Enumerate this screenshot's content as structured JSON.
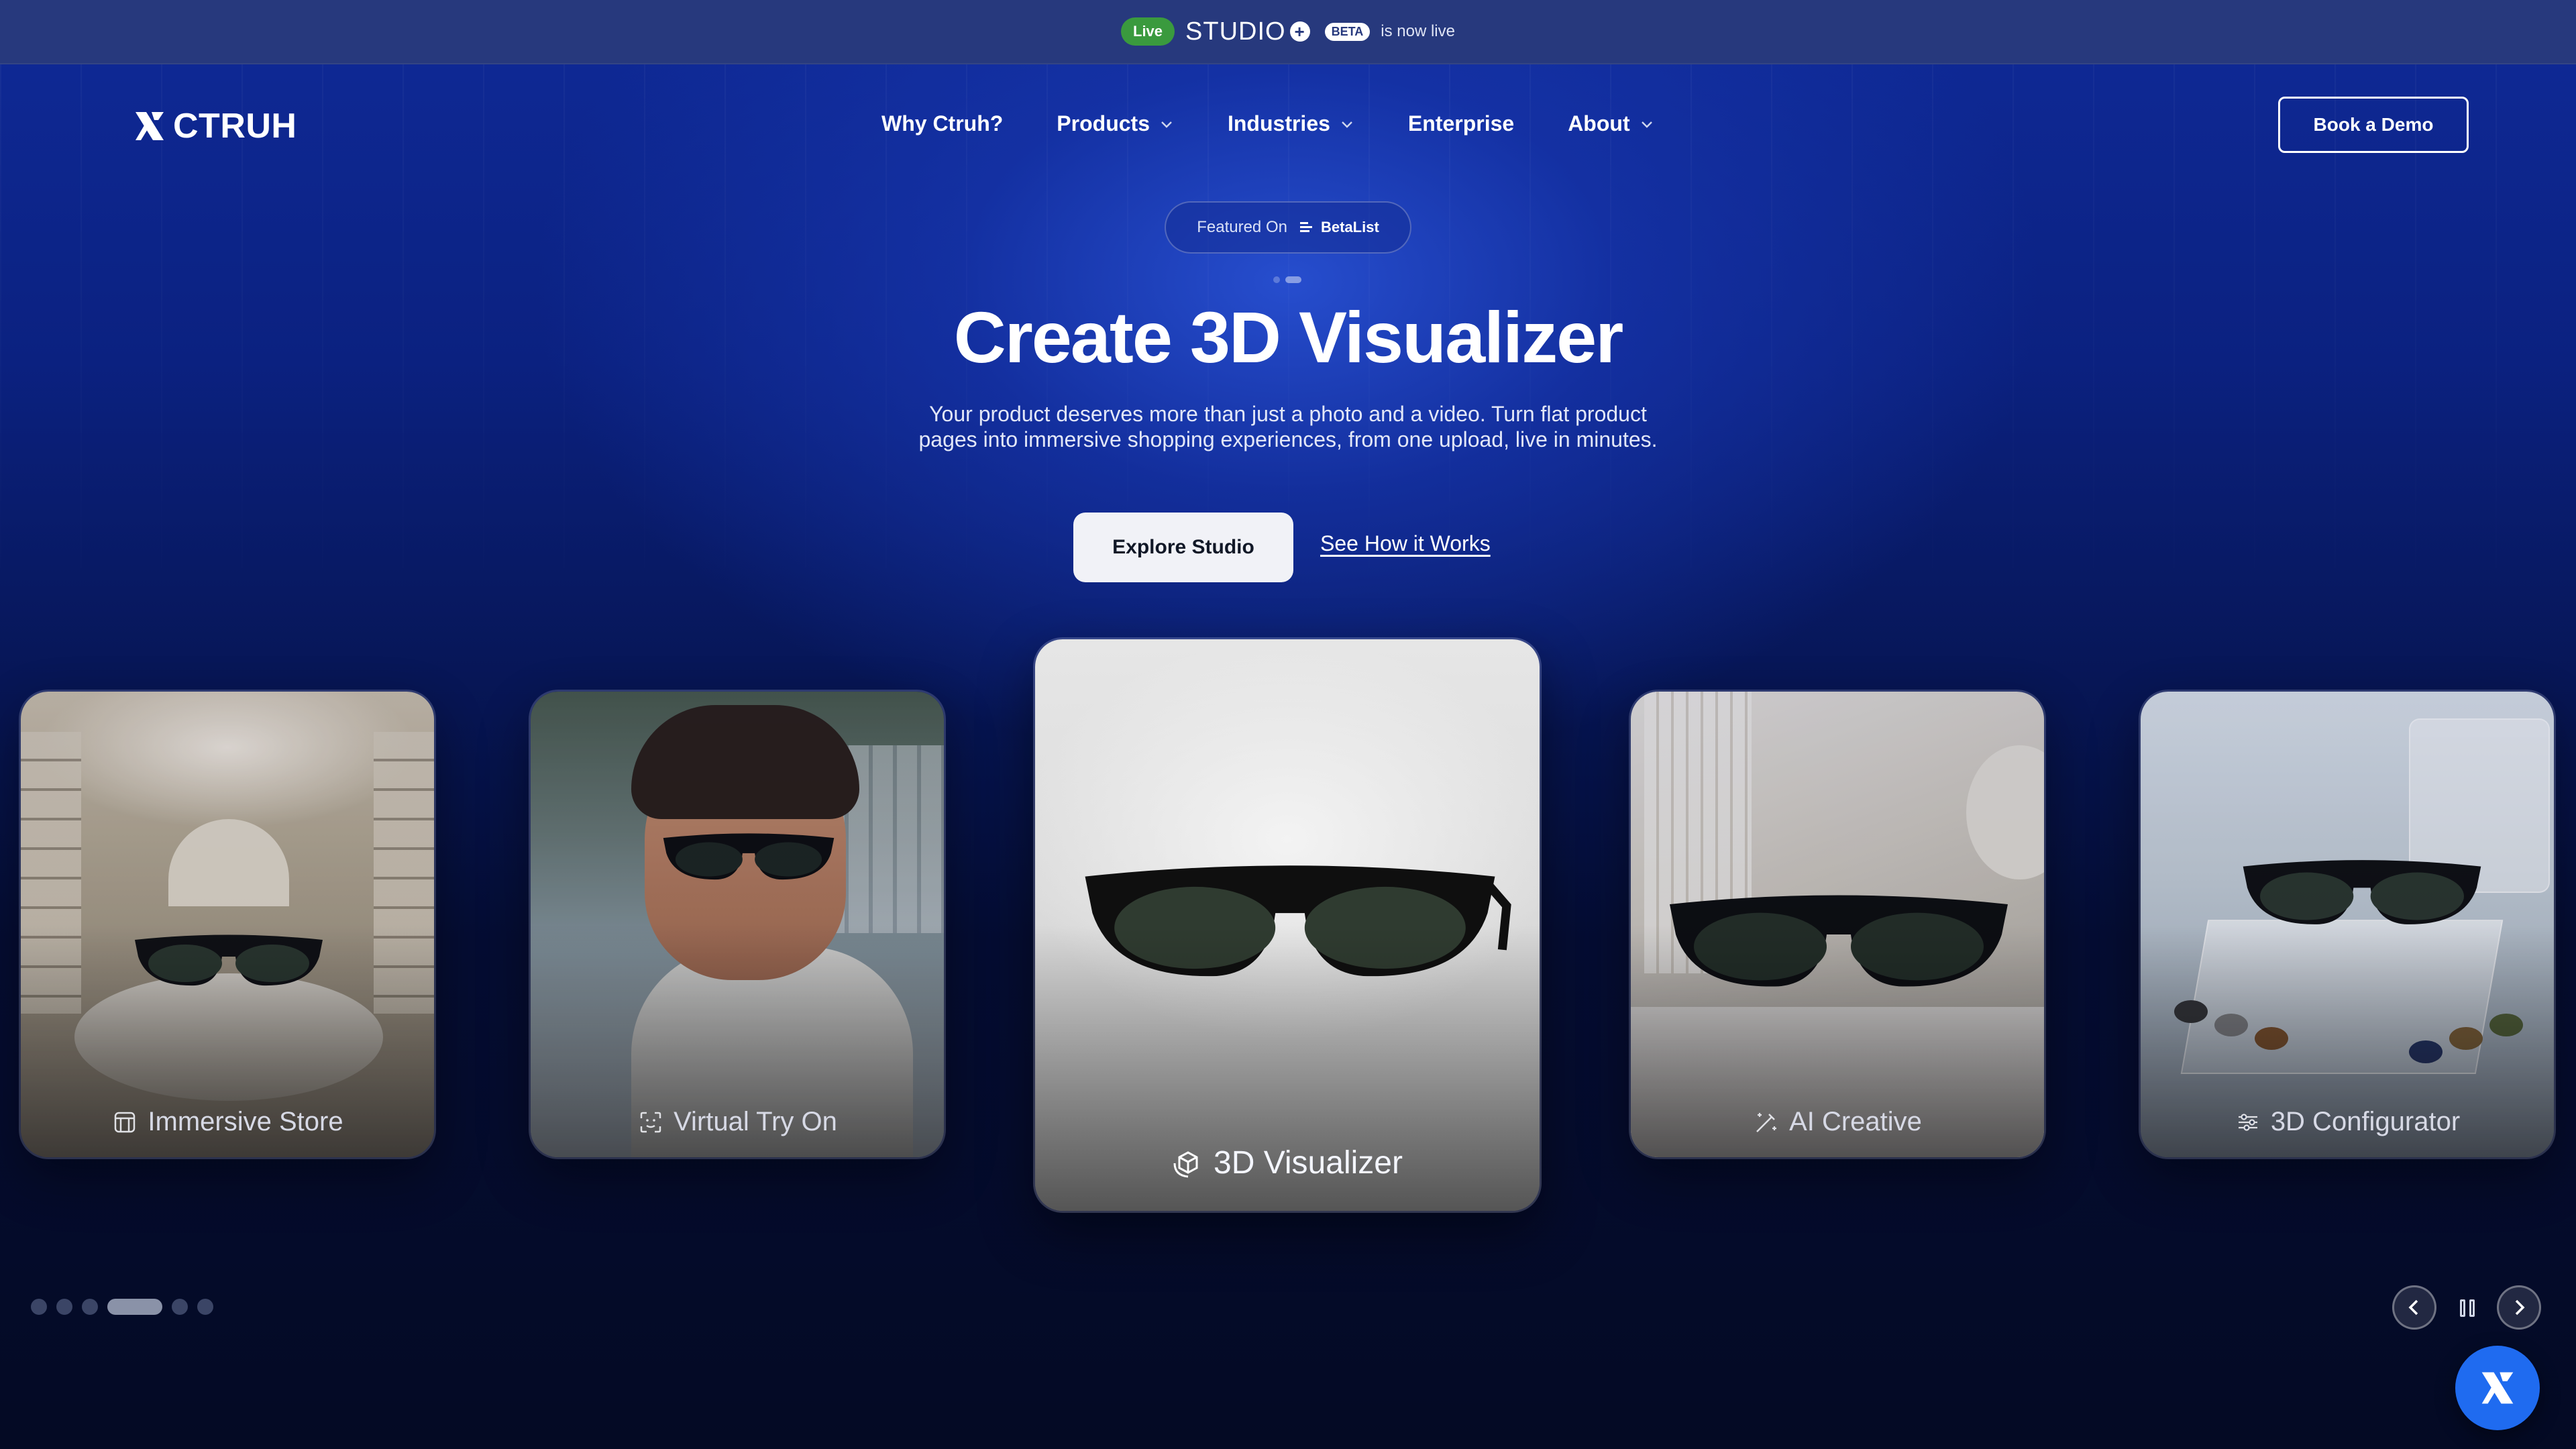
{
  "announcement": {
    "live_badge": "Live",
    "product_name": "STUDIO",
    "beta_badge": "BETA",
    "text": "is now live"
  },
  "header": {
    "brand": "CTRUH",
    "nav": [
      {
        "label": "Why Ctruh?",
        "has_dropdown": false
      },
      {
        "label": "Products",
        "has_dropdown": true
      },
      {
        "label": "Industries",
        "has_dropdown": true
      },
      {
        "label": "Enterprise",
        "has_dropdown": false
      },
      {
        "label": "About",
        "has_dropdown": true
      }
    ],
    "cta": "Book a Demo"
  },
  "featured": {
    "label": "Featured On",
    "source": "BetaList"
  },
  "hero": {
    "title": "Create 3D Visualizer",
    "subtitle": "Your product deserves more than just a photo and a video. Turn flat product pages into immersive shopping experiences, from one upload, live in minutes.",
    "primary_button": "Explore Studio",
    "secondary_link": "See How it Works"
  },
  "cards": [
    {
      "label": "Immersive Store",
      "icon": "store-icon"
    },
    {
      "label": "Virtual Try On",
      "icon": "face-scan-icon"
    },
    {
      "label": "3D Visualizer",
      "icon": "rotate-3d-icon",
      "active": true
    },
    {
      "label": "AI Creative",
      "icon": "magic-wand-icon"
    },
    {
      "label": "3D Configurator",
      "icon": "sliders-icon"
    }
  ],
  "carousel": {
    "total_slides": 6,
    "active_index": 3
  },
  "colors": {
    "announce_bg": "#27397d",
    "live_green": "#3a9a3e",
    "fab_blue": "#1f6bf0"
  }
}
